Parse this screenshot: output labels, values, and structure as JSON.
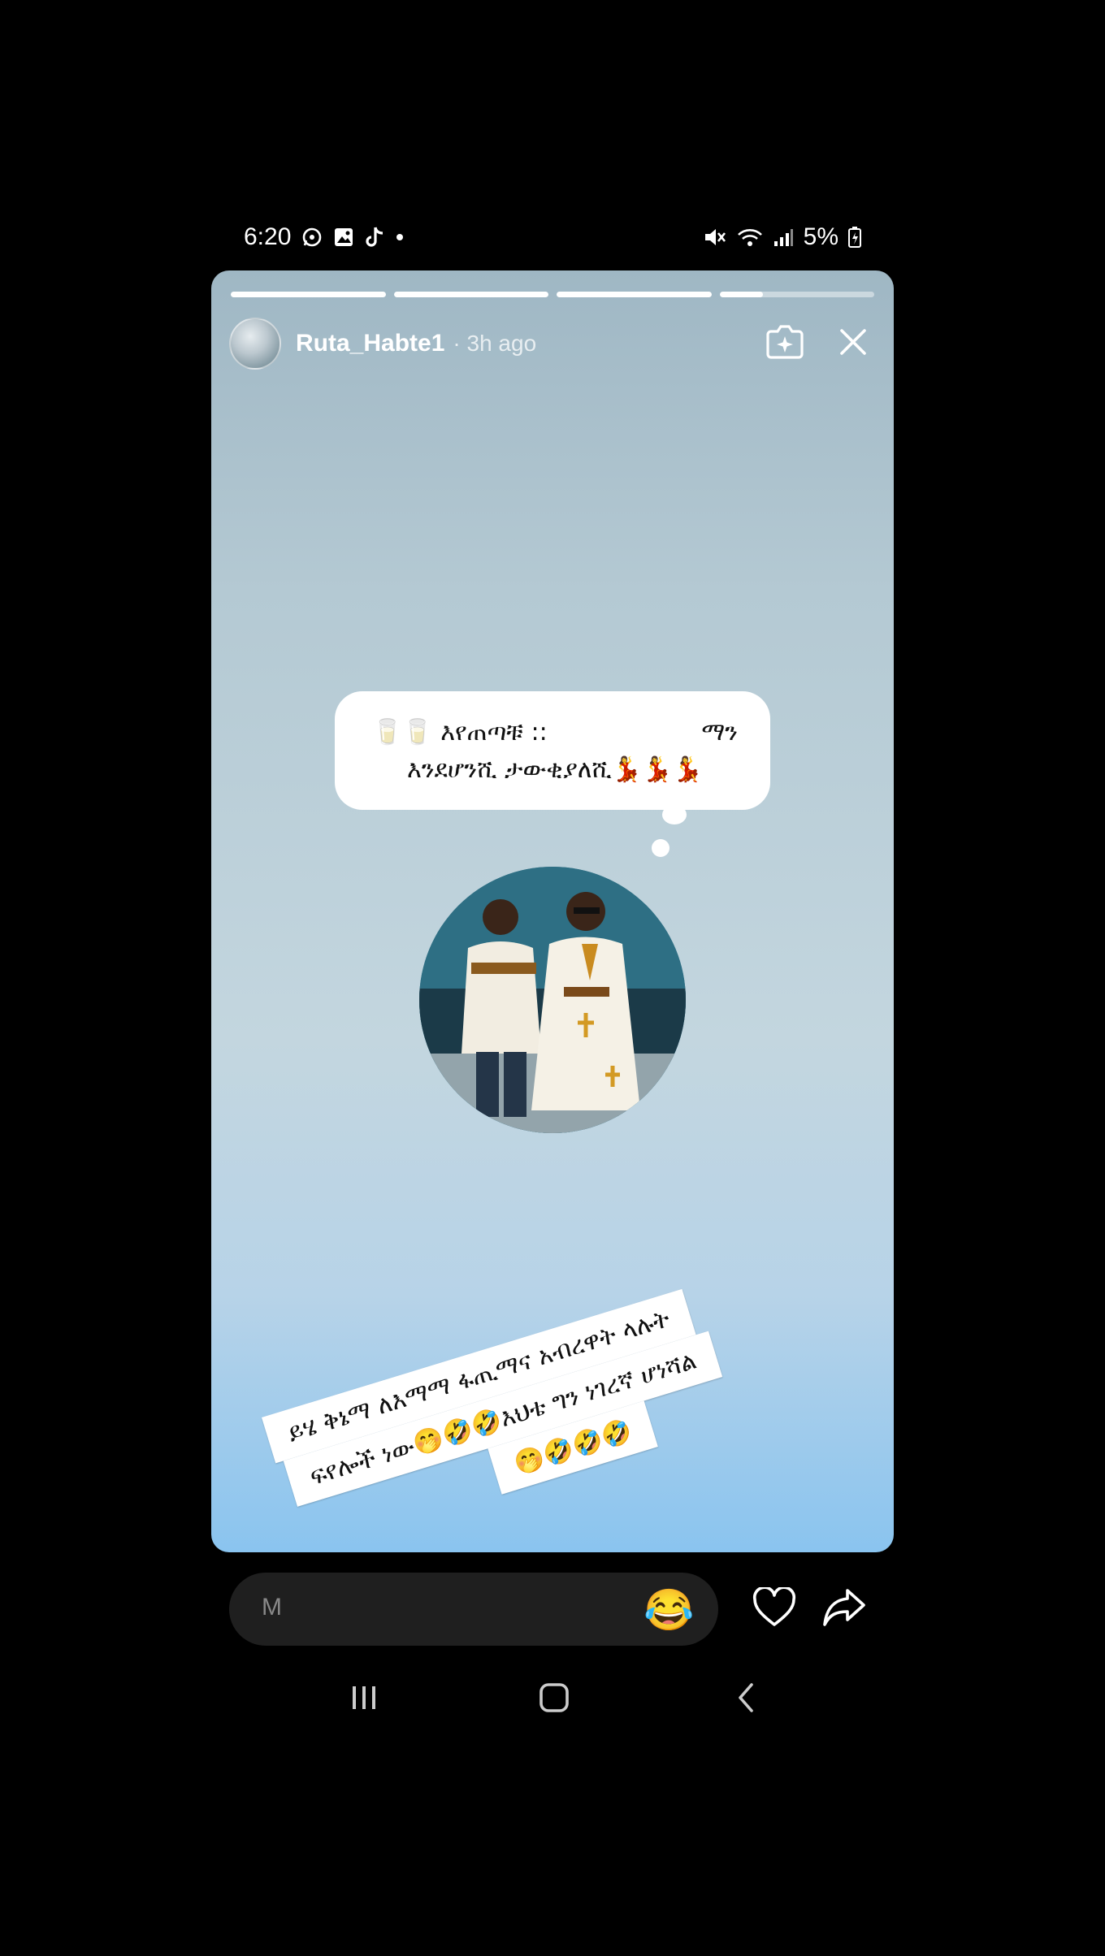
{
  "status_bar": {
    "time": "6:20",
    "battery": "5%",
    "left_icons": [
      "whatsapp-icon",
      "gallery-icon",
      "tiktok-icon",
      "dot-icon"
    ],
    "right_icons": [
      "mute-icon",
      "wifi-icon",
      "signal-icon",
      "battery-icon"
    ]
  },
  "story": {
    "progress": [
      1.0,
      1.0,
      1.0,
      0.28
    ],
    "username": "Ruta_Habte1",
    "time_ago": "· 3h ago",
    "header_icons": [
      "sparkle-icon",
      "close-icon"
    ]
  },
  "thought_bubble": {
    "line1_left": "🥛🥛 እየጠጣቹ ::",
    "line1_right": "ማን",
    "line2": "እንደሆንሺ ታውቂያለሺ💃💃💃"
  },
  "caption": {
    "line1": "ይሄ ቅኔማ  ለእማማ ፋጢማና  አብረዋት ላሉት",
    "line2": "ፍየሎች ነው🤭🤣🤣እህቴ ግን ነገረኛ ሆነሻል",
    "line3": "🤭🤣🤣🤣"
  },
  "bottom_bar": {
    "reply_placeholder": "M",
    "reaction_emoji": "😂",
    "icons": [
      "heart-icon",
      "share-icon"
    ]
  },
  "nav_bar": {
    "icons": [
      "recent-apps-icon",
      "home-icon",
      "back-icon"
    ]
  },
  "colors": {
    "story_top": "#9fb7c4",
    "story_bottom": "#8ac4ef",
    "pill": "#1f1f1f"
  }
}
